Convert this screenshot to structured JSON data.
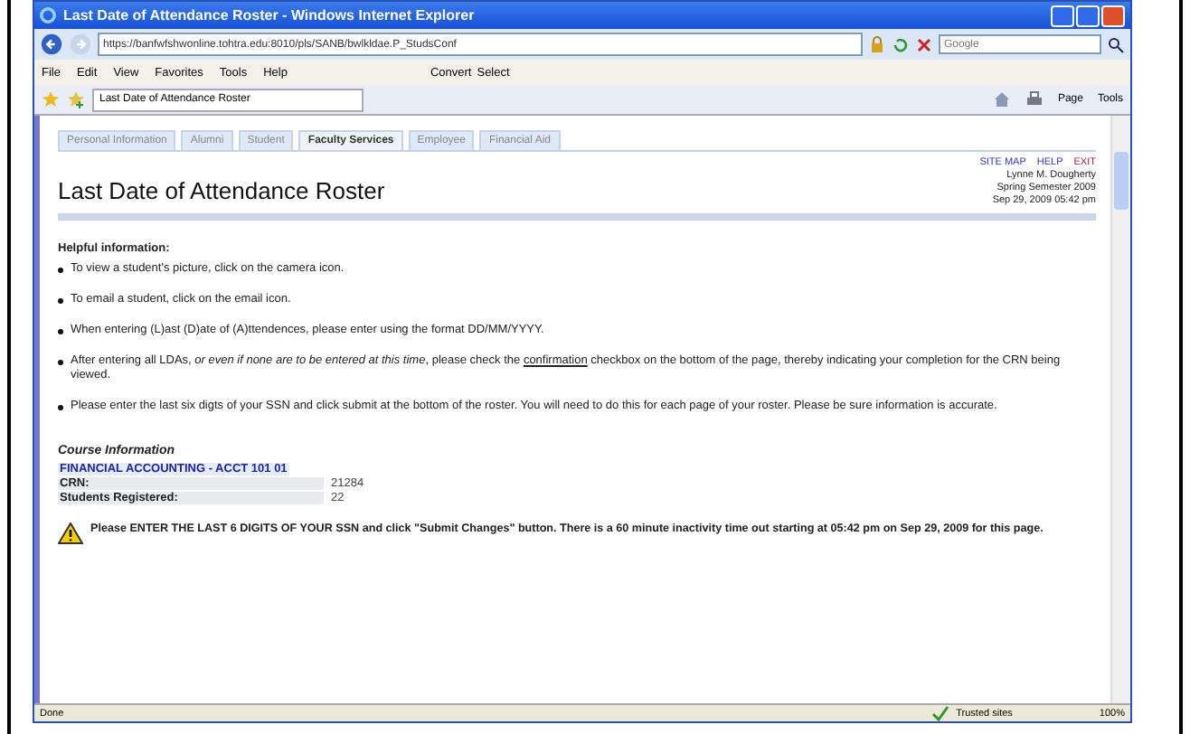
{
  "window": {
    "title": "Last Date of Attendance Roster - Windows Internet Explorer"
  },
  "address": {
    "url": "https://banfwfshwonline.tohtra.edu:8010/pls/SANB/bwlkldae.P_StudsConf"
  },
  "search": {
    "placeholder": "Google"
  },
  "menu": [
    "File",
    "Edit",
    "View",
    "Favorites",
    "Tools",
    "Help"
  ],
  "toolbar_links": [
    "Convert",
    "Select"
  ],
  "browser_tab": {
    "title": "Last Date of Attendance Roster"
  },
  "command_bar": [
    "Page",
    "Tools"
  ],
  "nav_tabs": [
    {
      "label": "Personal Information",
      "selected": false
    },
    {
      "label": "Alumni",
      "selected": false
    },
    {
      "label": "Student",
      "selected": false
    },
    {
      "label": "Faculty Services",
      "selected": true
    },
    {
      "label": "Employee",
      "selected": false
    },
    {
      "label": "Financial Aid",
      "selected": false
    }
  ],
  "header_links": [
    "SITE MAP",
    "HELP",
    "EXIT"
  ],
  "user_info": [
    "Lynne M. Dougherty",
    "Spring Semester 2009",
    "Sep 29, 2009 05:42 pm"
  ],
  "heading": "Last Date of Attendance Roster",
  "helpful_title": "Helpful information:",
  "bullets": [
    {
      "parts": [
        {
          "kind": "text",
          "text": "To view a student's picture, click on the camera icon."
        }
      ]
    },
    {
      "parts": [
        {
          "kind": "text",
          "text": "To email a student, click on the email icon."
        }
      ]
    },
    {
      "parts": [
        {
          "kind": "text",
          "text": "When entering (L)ast (D)ate of (A)ttendences, please enter using the format DD/MM/YYYY."
        }
      ]
    },
    {
      "parts": [
        {
          "kind": "text",
          "text": "After entering all LDAs, *or even if none are to be entered at this time*, please check the"
        },
        {
          "kind": "link",
          "text": "confirmation"
        },
        {
          "kind": "text",
          "text": "checkbox on the bottom of the page, thereby indicating your completion for the CRN being viewed."
        }
      ]
    },
    {
      "parts": [
        {
          "kind": "text",
          "text": "Please enter the last six digts of your SSN and click submit at the bottom of the roster. You will need to do this for each page of your roster. Please be sure information is accurate."
        }
      ]
    }
  ],
  "course": {
    "title": "Course Information",
    "name": "FINANCIAL ACCOUNTING - ACCT 101 01",
    "fields": [
      {
        "label": "CRN:",
        "value": "21284"
      },
      {
        "label": "Students Registered:",
        "value": "22"
      }
    ]
  },
  "warning": "Please ENTER THE LAST 6 DIGITS OF YOUR SSN and click \"Submit Changes\" button. There is a 60 minute inactivity time out starting at 05:42 pm on Sep 29, 2009 for this page.",
  "status_bar": {
    "status": "Done",
    "zone": "Trusted sites",
    "zoom": "100%"
  }
}
